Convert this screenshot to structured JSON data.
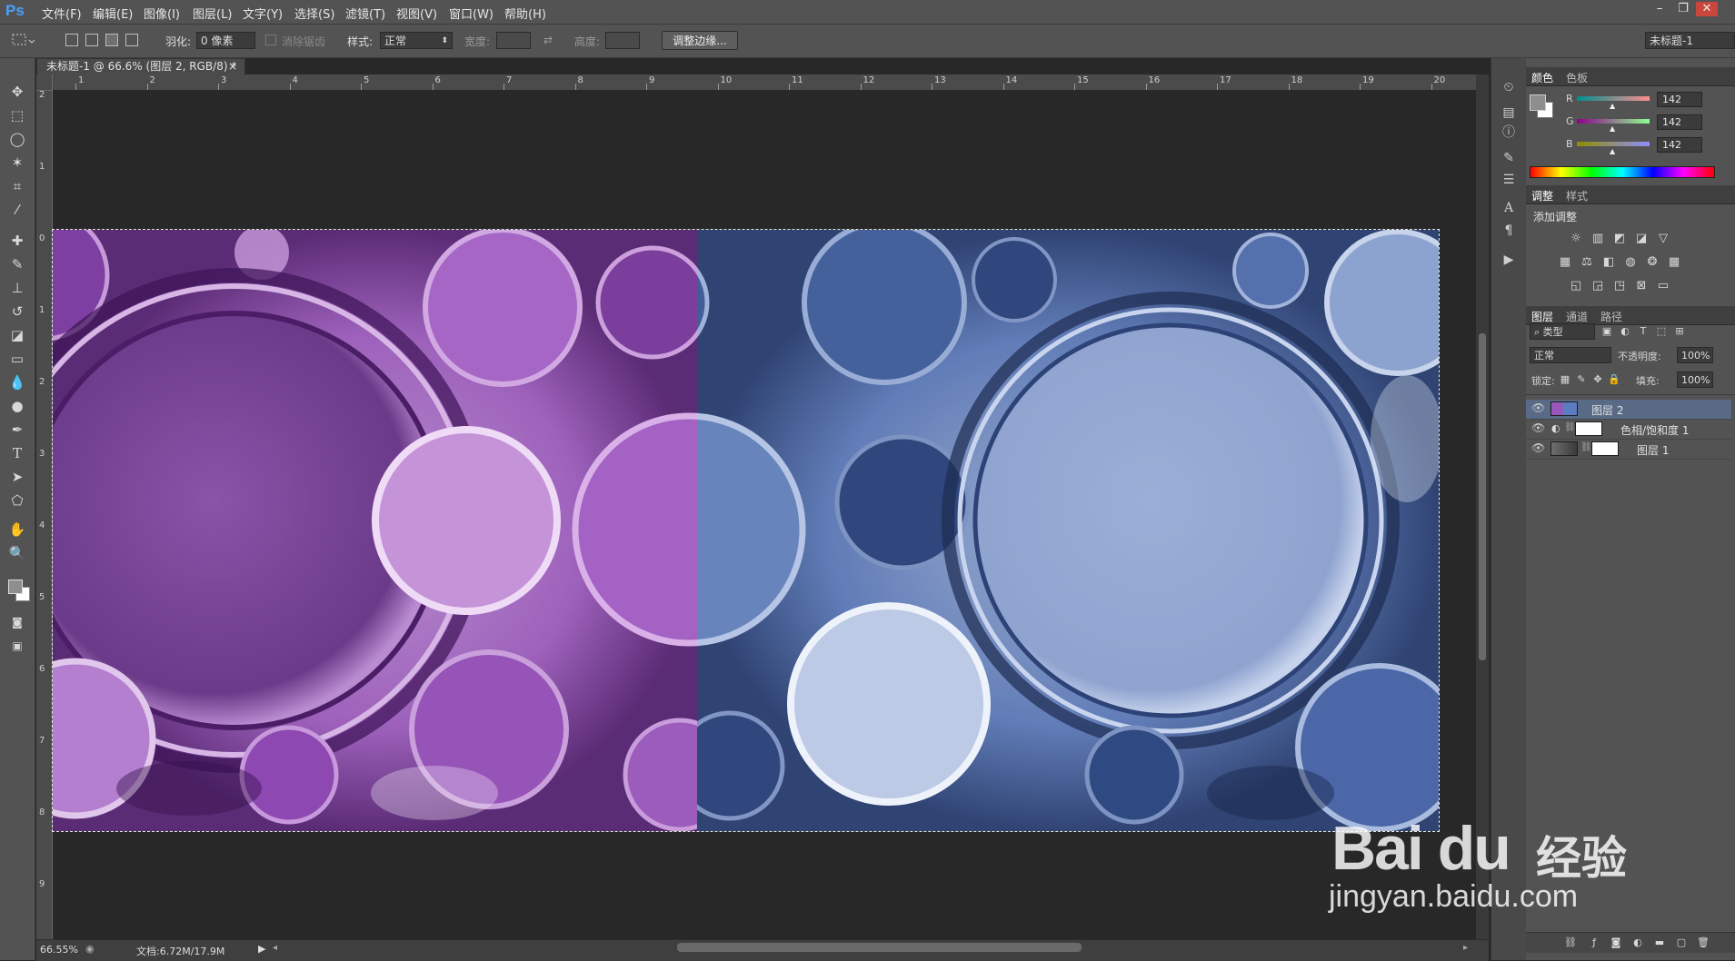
{
  "app": {
    "logo": "Ps"
  },
  "menu": [
    "文件(F)",
    "编辑(E)",
    "图像(I)",
    "图层(L)",
    "文字(Y)",
    "选择(S)",
    "滤镜(T)",
    "视图(V)",
    "窗口(W)",
    "帮助(H)"
  ],
  "window_controls": {
    "minimize": "–",
    "restore": "❐",
    "close": "✕"
  },
  "options": {
    "feather_label": "羽化:",
    "feather_value": "0 像素",
    "antialias_label": "消除锯齿",
    "style_label": "样式:",
    "style_value": "正常",
    "width_label": "宽度:",
    "height_label": "高度:",
    "refine_edge": "调整边缘...",
    "workspace_selector": "未标题-1"
  },
  "document": {
    "tab_title": "未标题-1 @ 66.6% (图层 2, RGB/8) *",
    "close": "×"
  },
  "rulers": {
    "top": [
      "1",
      "2",
      "3",
      "4",
      "5",
      "6",
      "7",
      "8",
      "9",
      "10",
      "11",
      "12",
      "13",
      "14",
      "15",
      "16",
      "17",
      "18",
      "19",
      "20"
    ],
    "left": [
      "2",
      "1",
      "0",
      "1",
      "2",
      "3",
      "4",
      "5",
      "6",
      "7",
      "8",
      "9"
    ]
  },
  "status": {
    "zoom": "66.55%",
    "doc_size": "文档:6.72M/17.9M"
  },
  "color_panel": {
    "tabs": [
      "颜色",
      "色板"
    ],
    "channels": [
      {
        "label": "R",
        "value": "142"
      },
      {
        "label": "G",
        "value": "142"
      },
      {
        "label": "B",
        "value": "142"
      }
    ],
    "foreground": "#8e8e8e",
    "background": "#ffffff"
  },
  "adjustments_panel": {
    "tabs": [
      "调整",
      "样式"
    ],
    "add_label": "添加调整"
  },
  "layers_panel": {
    "tabs": [
      "图层",
      "通道",
      "路径"
    ],
    "filter_kind": "类型",
    "blend_mode": "正常",
    "opacity_label": "不透明度:",
    "opacity_value": "100%",
    "lock_label": "锁定:",
    "fill_label": "填充:",
    "fill_value": "100%",
    "layers": [
      {
        "name": "图层 2"
      },
      {
        "name": "色相/饱和度 1"
      },
      {
        "name": "图层 1"
      }
    ]
  },
  "watermark": {
    "logo": "Bai du",
    "cn": "经验",
    "url": "jingyan.baidu.com"
  },
  "colors": {
    "left_half_tint": "#9a55b8",
    "right_half_tint": "#5b7cc0"
  }
}
